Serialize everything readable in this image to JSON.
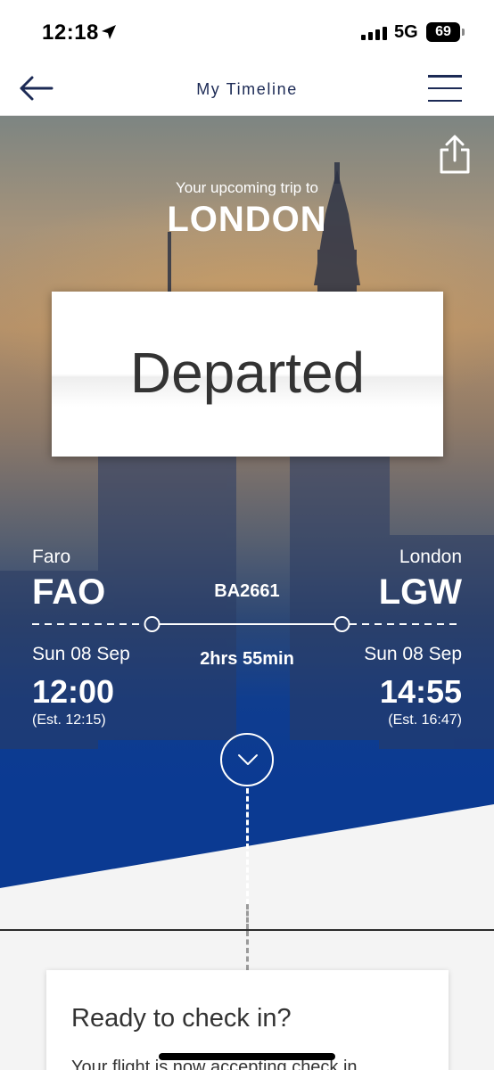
{
  "status_bar": {
    "time": "12:18",
    "network": "5G",
    "battery": "69",
    "icons": [
      "location-arrow-icon",
      "signal-bars-icon",
      "battery-icon"
    ]
  },
  "nav": {
    "title": "My Timeline",
    "back_icon": "arrow-left-icon",
    "menu_icon": "hamburger-menu-icon"
  },
  "hero": {
    "share_icon": "share-icon",
    "trip_label": "Your upcoming trip to",
    "destination": "LONDON",
    "flight_status": "Departed",
    "flight_number": "BA2661",
    "duration": "2hrs 55min",
    "departure": {
      "city": "Faro",
      "code": "FAO",
      "date": "Sun 08 Sep",
      "time": "12:00",
      "estimate": "(Est. 12:15)"
    },
    "arrival": {
      "city": "London",
      "code": "LGW",
      "date": "Sun 08 Sep",
      "time": "14:55",
      "estimate": "(Est. 16:47)"
    },
    "expand_icon": "chevron-down-icon"
  },
  "checkin_card": {
    "title": "Ready to check in?",
    "description": "Your flight is now accepting check in"
  },
  "colors": {
    "brand_navy": "#1c2a55",
    "hero_blue": "#0b3a92"
  }
}
